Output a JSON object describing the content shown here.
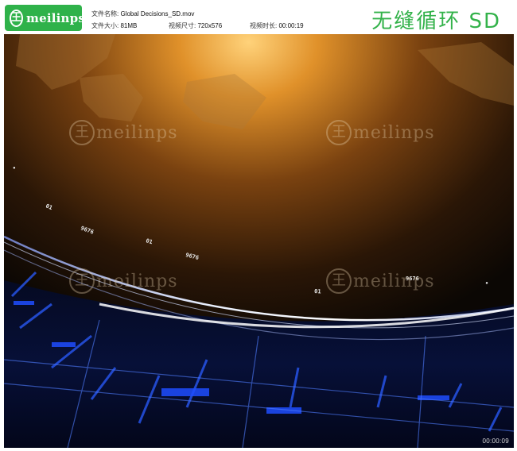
{
  "brand": {
    "logo_text": "meilinps",
    "logo_glyph": "王",
    "accent_color": "#2fb24a"
  },
  "file_info": {
    "name_label": "文件名称:",
    "name_value": "Global Decisions_SD.mov",
    "size_label": "文件大小:",
    "size_value": "81MB",
    "dims_label": "视频尺寸:",
    "dims_value": "720x576",
    "duration_label": "视频时长:",
    "duration_value": "00:00:19"
  },
  "title": "无缝循环 SD",
  "video": {
    "timestamp": "00:00:09",
    "ring_numbers": [
      "01",
      "9676",
      "01",
      "9676",
      "01",
      "9676",
      "01",
      "9676",
      "01"
    ],
    "watermark_text": "meilinps"
  }
}
